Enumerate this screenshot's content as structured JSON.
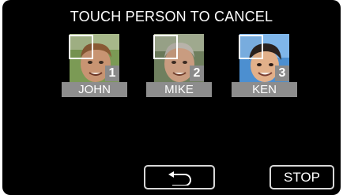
{
  "header": {
    "title": "TOUCH PERSON TO CANCEL"
  },
  "people": [
    {
      "number": "1",
      "name": "JOHN"
    },
    {
      "number": "2",
      "name": "MIKE"
    },
    {
      "number": "3",
      "name": "KEN"
    }
  ],
  "buttons": {
    "back_icon": "return-arrow-icon",
    "stop_label": "STOP"
  },
  "colors": {
    "background": "#000000",
    "label_bg": "#8d8d8d",
    "button_border": "#d8d8d8"
  }
}
